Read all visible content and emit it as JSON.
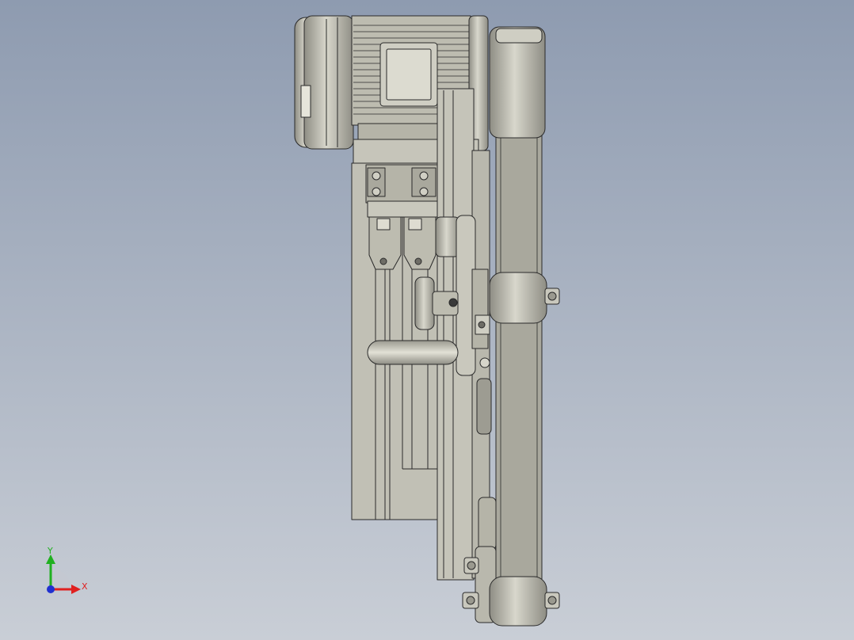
{
  "viewport": {
    "background_top": "#8e9bb0",
    "background_bottom": "#c9ced6"
  },
  "model": {
    "part_fill": "#bdbcb0",
    "part_light": "#d8d7cc",
    "part_dark": "#8e8d84",
    "edge_color": "#2a2a2a"
  },
  "triad": {
    "x_label": "X",
    "y_label": "Y",
    "x_color": "#e02020",
    "y_color": "#20b020",
    "z_color": "#2030d0"
  }
}
